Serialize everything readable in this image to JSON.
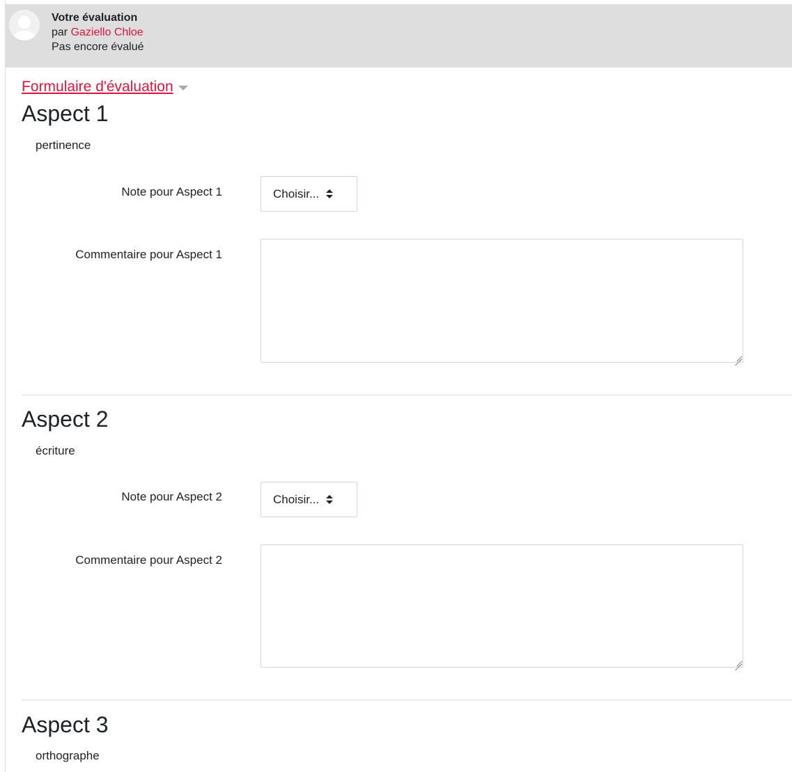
{
  "header": {
    "title": "Votre évaluation",
    "by_prefix": "par ",
    "author": "Gaziello Chloe",
    "status": "Pas encore évalué",
    "accent_color": "#e2133c"
  },
  "form": {
    "title": "Formulaire d'évaluation"
  },
  "aspects": [
    {
      "title": "Aspect 1",
      "description": "pertinence",
      "grade_label": "Note pour Aspect 1",
      "grade_value": "Choisir...",
      "comment_label": "Commentaire pour Aspect 1",
      "comment_value": ""
    },
    {
      "title": "Aspect 2",
      "description": "écriture",
      "grade_label": "Note pour Aspect 2",
      "grade_value": "Choisir...",
      "comment_label": "Commentaire pour Aspect 2",
      "comment_value": ""
    },
    {
      "title": "Aspect 3",
      "description": "orthographe"
    }
  ]
}
